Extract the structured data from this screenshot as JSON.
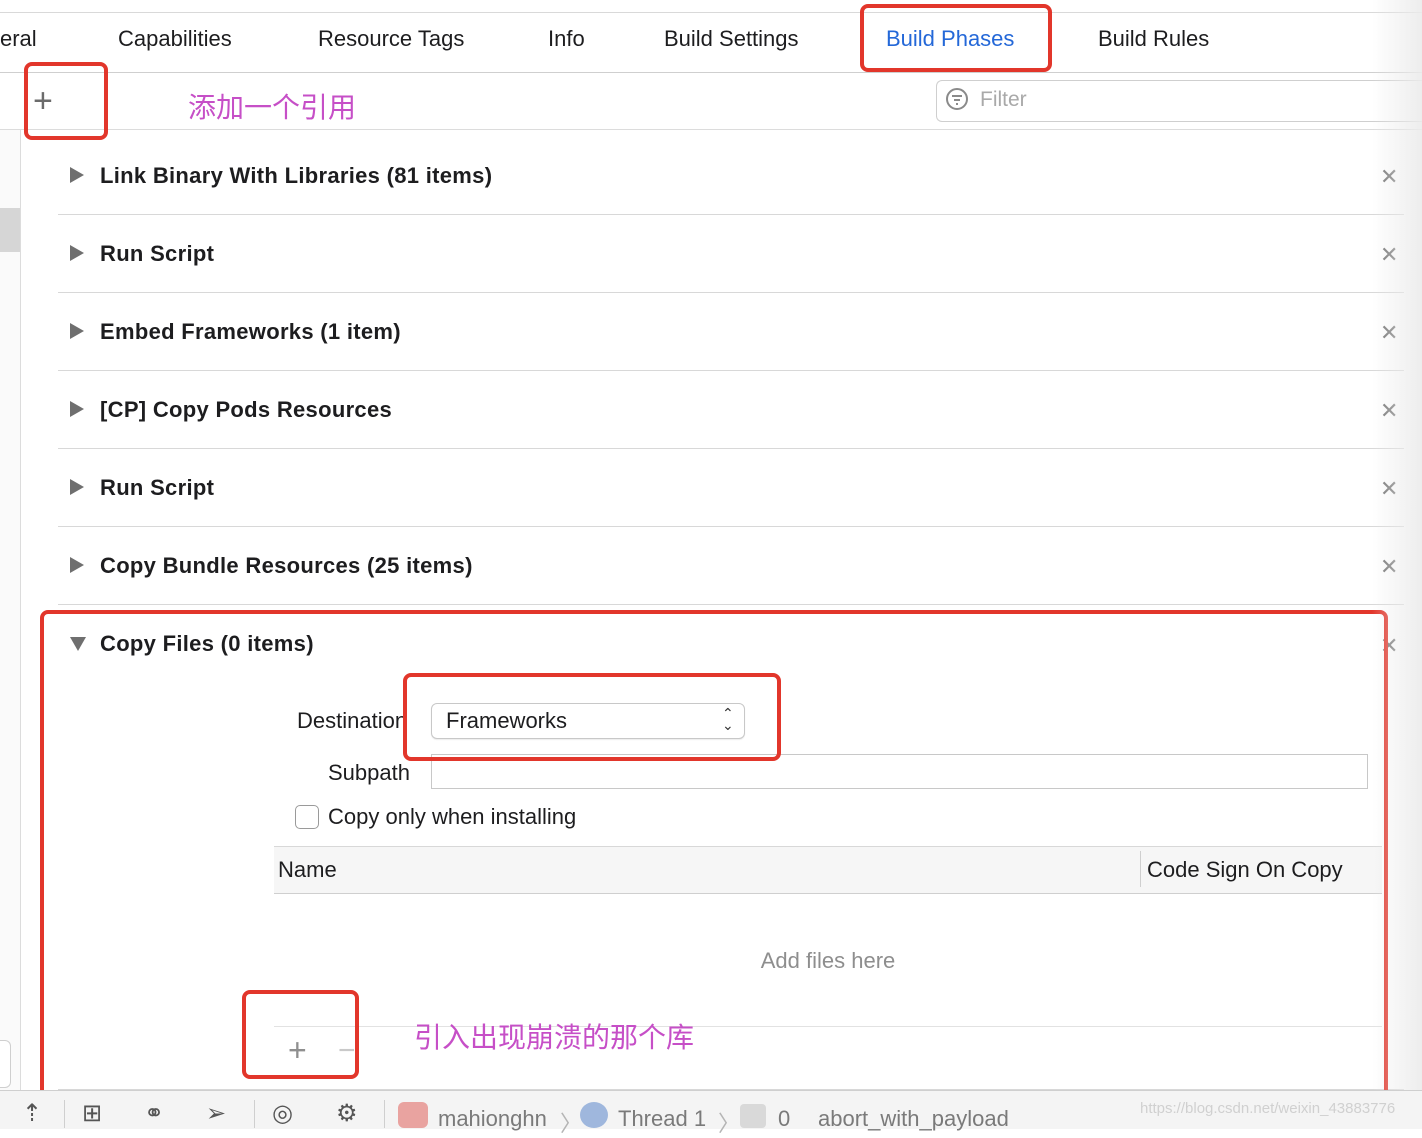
{
  "tabs": [
    {
      "label": "eral"
    },
    {
      "label": "Capabilities"
    },
    {
      "label": "Resource Tags"
    },
    {
      "label": "Info"
    },
    {
      "label": "Build Settings"
    },
    {
      "label": "Build Phases",
      "active": true
    },
    {
      "label": "Build Rules"
    }
  ],
  "toolbar": {
    "add_icon": "plus-icon",
    "filter_placeholder": "Filter",
    "filter_icon": "filter-icon"
  },
  "annotations": {
    "add_reference": "添加一个引用",
    "import_crash_lib": "引入出现崩溃的那个库"
  },
  "phases": [
    {
      "title": "Link Binary With Libraries (81 items)",
      "expanded": false
    },
    {
      "title": "Run Script",
      "expanded": false
    },
    {
      "title": "Embed Frameworks (1 item)",
      "expanded": false
    },
    {
      "title": "[CP] Copy Pods Resources",
      "expanded": false
    },
    {
      "title": "Run Script",
      "expanded": false
    },
    {
      "title": "Copy Bundle Resources (25 items)",
      "expanded": false
    },
    {
      "title": "Copy Files (0 items)",
      "expanded": true
    }
  ],
  "copy_files": {
    "destination_label": "Destination",
    "destination_value": "Frameworks",
    "subpath_label": "Subpath",
    "subpath_value": "",
    "copy_only_label": "Copy only when installing",
    "copy_only_checked": false,
    "columns": [
      "Name",
      "Code Sign On Copy"
    ],
    "empty_text": "Add files here"
  },
  "debug_bar": {
    "target": "mahionghn",
    "thread": "Thread 1",
    "frame": "0",
    "function": "abort_with_payload"
  },
  "watermark": "https://blog.csdn.net/weixin_43883776",
  "colors": {
    "accent": "#2468d8",
    "annotation_box": "#e2362b",
    "annotation_text": "#c64fc7"
  }
}
